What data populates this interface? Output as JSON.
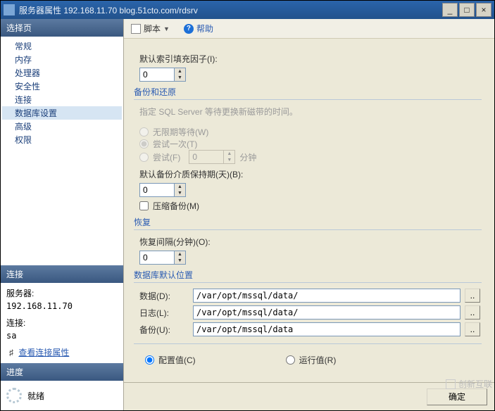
{
  "titlebar": {
    "title": "服务器属性  192.168.11.70   blog.51cto.com/rdsrv"
  },
  "left": {
    "select_page": "选择页",
    "pages": [
      "常规",
      "内存",
      "处理器",
      "安全性",
      "连接",
      "数据库设置",
      "高级",
      "权限"
    ],
    "selected_index": 5,
    "connection_header": "连接",
    "server_label": "服务器:",
    "server_value": "192.168.11.70",
    "conn_label": "连接:",
    "conn_value": "sa",
    "view_conn_props": "查看连接属性",
    "progress_header": "进度",
    "ready": "就绪"
  },
  "toolbar": {
    "script": "脚本",
    "help": "帮助"
  },
  "content": {
    "fill_factor_label": "默认索引填充因子(I):",
    "fill_factor_value": "0",
    "backup_restore": "备份和还原",
    "backup_hint": "指定 SQL Server 等待更换新磁带的时间。",
    "wait_indef": "无限期等待(W)",
    "try_once": "尝试一次(T)",
    "try_label": "尝试(F)",
    "try_value": "0",
    "minutes": "分钟",
    "media_retention_label": "默认备份介质保持期(天)(B):",
    "media_retention_value": "0",
    "compress_backup": "压缩备份(M)",
    "recovery": "恢复",
    "recovery_interval_label": "恢复间隔(分钟)(O):",
    "recovery_interval_value": "0",
    "db_default_loc": "数据库默认位置",
    "data_label": "数据(D):",
    "data_path": "/var/opt/mssql/data/",
    "log_label": "日志(L):",
    "log_path": "/var/opt/mssql/data/",
    "backup_label": "备份(U):",
    "backup_path": "/var/opt/mssql/data",
    "configured": "配置值(C)",
    "running": "运行值(R)"
  },
  "footer": {
    "ok": "确定"
  },
  "watermark": "创新互联"
}
